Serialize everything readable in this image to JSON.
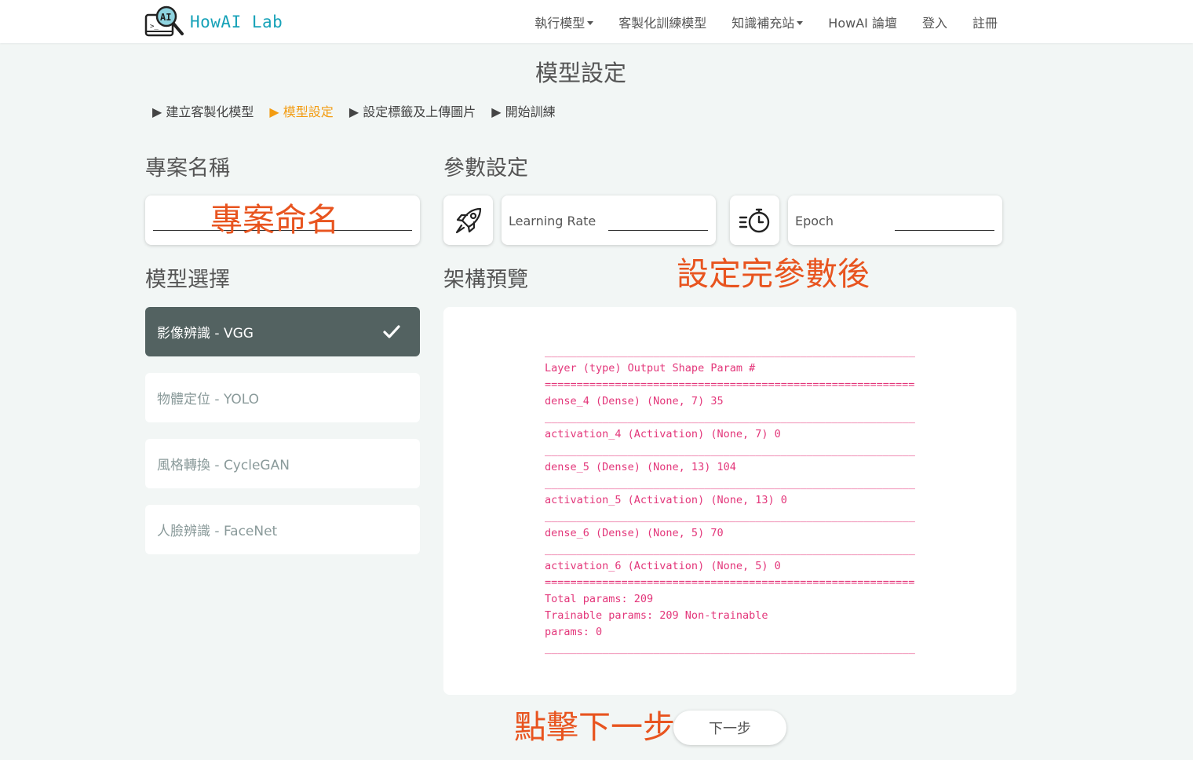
{
  "brand": {
    "name": "HowAI Lab",
    "logo_icon": "magnifier-ai-icon"
  },
  "nav": {
    "items": [
      {
        "label": "執行模型",
        "dropdown": true
      },
      {
        "label": "客製化訓練模型",
        "dropdown": false
      },
      {
        "label": "知識補充站",
        "dropdown": true
      },
      {
        "label": "HowAI 論壇",
        "dropdown": false
      },
      {
        "label": "登入",
        "dropdown": false
      },
      {
        "label": "註冊",
        "dropdown": false
      }
    ]
  },
  "page_title": "模型設定",
  "steps": [
    {
      "label": "▶ 建立客製化模型",
      "active": false
    },
    {
      "label": "▶ 模型設定",
      "active": true
    },
    {
      "label": "▶ 設定標籤及上傳圖片",
      "active": false
    },
    {
      "label": "▶ 開始訓練",
      "active": false
    }
  ],
  "project": {
    "title": "專案名稱",
    "value": "",
    "annotation": "專案命名"
  },
  "params": {
    "title": "參數設定",
    "learning_rate": {
      "label": "Learning Rate",
      "value": "",
      "icon": "rocket-icon"
    },
    "epoch": {
      "label": "Epoch",
      "value": "",
      "icon": "timer-icon"
    },
    "annotation": "設定完參數後"
  },
  "model_select": {
    "title": "模型選擇",
    "items": [
      {
        "label": "影像辨識 - VGG",
        "selected": true
      },
      {
        "label": "物體定位 - YOLO",
        "selected": false
      },
      {
        "label": "風格轉換 - CycleGAN",
        "selected": false
      },
      {
        "label": "人臉辨識 - FaceNet",
        "selected": false
      }
    ]
  },
  "preview": {
    "title": "架構預覽",
    "lines": [
      "________________________________________________________________",
      "Layer (type) Output Shape Param #",
      "================================================================",
      "dense_4 (Dense) (None, 7) 35",
      "________________________________________________________________",
      "activation_4 (Activation) (None, 7) 0",
      "________________________________________________________________",
      "dense_5 (Dense) (None, 13) 104",
      "________________________________________________________________",
      "activation_5 (Activation) (None, 13) 0",
      "________________________________________________________________",
      "dense_6 (Dense) (None, 5) 70",
      "________________________________________________________________",
      "activation_6 (Activation) (None, 5) 0",
      "================================================================",
      "Total params: 209",
      "Trainable params: 209 Non-trainable",
      "params: 0",
      "________________________________________________________________"
    ]
  },
  "next": {
    "label": "下一步",
    "annotation": "點擊下一步"
  },
  "colors": {
    "accent": "#17a2b8",
    "active_step": "#f39c12",
    "selected_item": "#536261",
    "annotation": "#e8541f",
    "summary_text": "#e3367a"
  }
}
